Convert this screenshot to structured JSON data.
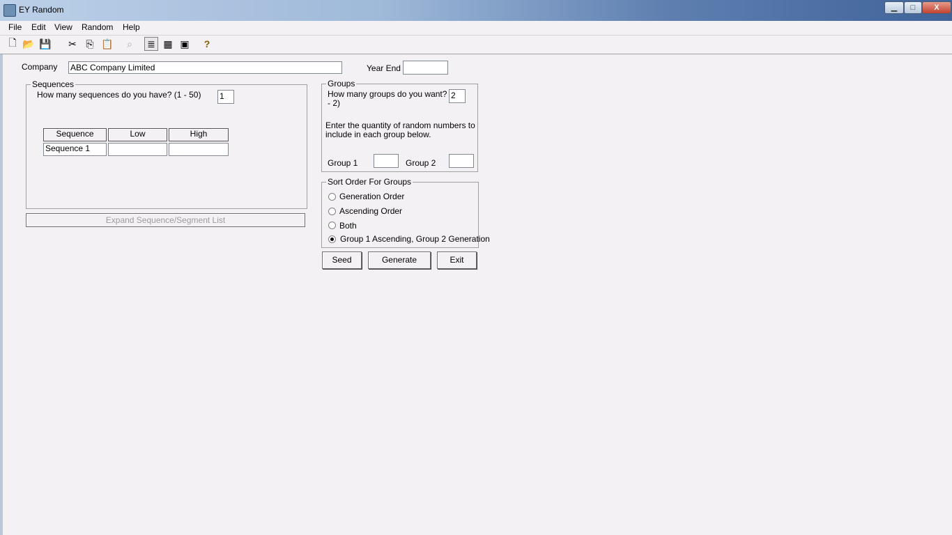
{
  "window": {
    "title": "EY Random",
    "minimize": "▁",
    "maximize": "□",
    "close": "X"
  },
  "menu": [
    "File",
    "Edit",
    "View",
    "Random",
    "Help"
  ],
  "toolbar": {
    "icons": [
      "new-icon",
      "open-icon",
      "save-icon",
      "cut-icon",
      "copy-icon",
      "paste-icon",
      "find-icon",
      "list-view-icon",
      "grid-view-icon",
      "details-view-icon",
      "help-icon"
    ],
    "glyphs": [
      "🗋",
      "📂",
      "💾",
      "✂",
      "⎘",
      "📋",
      "⌕",
      "≣",
      "▦",
      "▣",
      "?"
    ]
  },
  "company": {
    "label": "Company",
    "value": "ABC Company Limited"
  },
  "year_end": {
    "label": "Year End",
    "value": ""
  },
  "sequences": {
    "title": "Sequences",
    "question": "How many sequences do you have?  (1 - 50)",
    "count": "1",
    "columns": [
      "Sequence",
      "Low",
      "High"
    ],
    "rows": [
      {
        "name": "Sequence 1",
        "low": "",
        "high": ""
      }
    ],
    "expand_button": "Expand Sequence/Segment List"
  },
  "groups": {
    "title": "Groups",
    "question_line1": "How many groups do you want?  (1",
    "question_line2": "- 2)",
    "count": "2",
    "instruction_line1": "Enter the quantity of random numbers to",
    "instruction_line2": "include in each group below.",
    "group1_label": "Group 1",
    "group1_value": "",
    "group2_label": "Group 2",
    "group2_value": ""
  },
  "sort_order": {
    "title": "Sort Order For Groups",
    "options": [
      "Generation Order",
      "Ascending Order",
      "Both",
      "Group 1 Ascending,  Group 2 Generation"
    ],
    "selected": "Group 1 Ascending,  Group 2 Generation"
  },
  "buttons": {
    "seed": "Seed",
    "generate": "Generate",
    "exit": "Exit"
  }
}
